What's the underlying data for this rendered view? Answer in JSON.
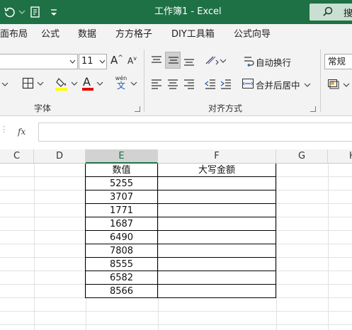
{
  "titlebar": {
    "title": "工作簿1  -  Excel",
    "search_label": "搜",
    "quick_access": [
      "undo-icon",
      "redo-icon",
      "save-layout-icon",
      "customize-icon"
    ]
  },
  "menu": {
    "tabs": [
      "页面布局",
      "公式",
      "数据",
      "方方格子",
      "DIY工具箱",
      "公式向导"
    ]
  },
  "ribbon": {
    "font": {
      "font_name": "",
      "font_size": "11",
      "group_label": "字体",
      "grow_font": "A",
      "shrink_font": "A",
      "pinyin_top": "wén",
      "pinyin_bottom": "文"
    },
    "alignment": {
      "wrap_text": "自动换行",
      "merge_center": "合并后居中",
      "group_label": "对齐方式"
    },
    "number": {
      "format": "常规"
    },
    "colors": {
      "fill_color": "#ffff00",
      "font_color": "#e60000",
      "accent": "#1e7145"
    }
  },
  "formula_bar": {
    "fx_label": "fx",
    "content": ""
  },
  "sheet": {
    "columns": [
      "C",
      "D",
      "E",
      "F",
      "G",
      "H"
    ],
    "selected_column": "E",
    "table": {
      "headers": [
        "数值",
        "大写金额"
      ],
      "values": [
        "5255",
        "3707",
        "1771",
        "1687",
        "6490",
        "7808",
        "8555",
        "6582",
        "8566"
      ]
    }
  }
}
